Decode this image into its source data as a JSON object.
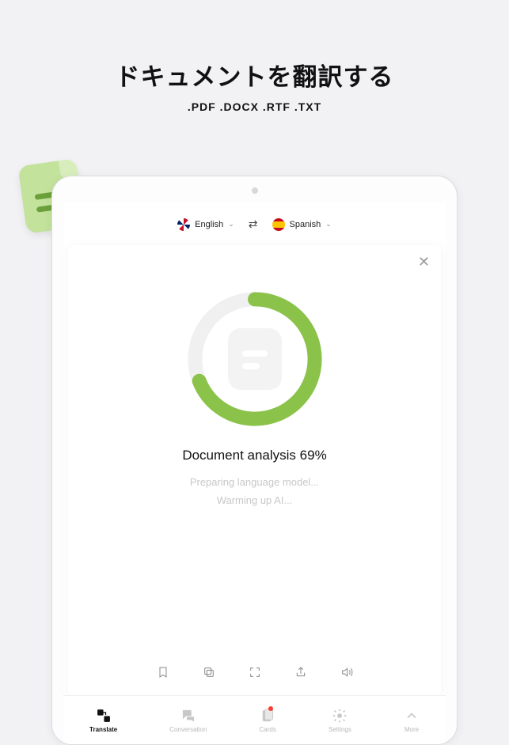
{
  "promo": {
    "title": "ドキュメントを翻訳する",
    "subtitle": ".PDF .DOCX .RTF .TXT"
  },
  "langBar": {
    "source": "English",
    "target": "Spanish"
  },
  "progress": {
    "percent": 69,
    "label": "Document analysis 69%",
    "status1": "Preparing language model...",
    "status2": "Warming up AI..."
  },
  "tabs": {
    "translate": "Translate",
    "conversation": "Conversation",
    "cards": "Cards",
    "settings": "Settings",
    "more": "More"
  }
}
